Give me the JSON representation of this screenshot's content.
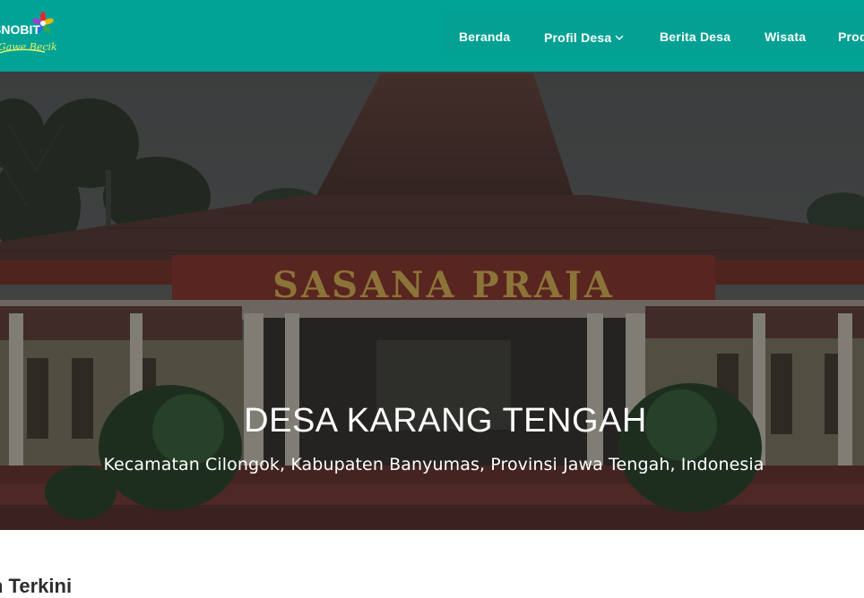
{
  "header": {
    "logo_text": "SNOBIT",
    "logo_tagline": "Gawe Becik",
    "nav": [
      {
        "label": "Beranda"
      },
      {
        "label": "Profil Desa"
      },
      {
        "label": "Berita Desa"
      },
      {
        "label": "Wisata"
      },
      {
        "label": "Prod"
      }
    ]
  },
  "hero": {
    "building_sign": "SASANA PRAJA",
    "title": "DESA KARANG TENGAH",
    "subtitle": "Kecamatan Cilongok, Kabupaten Banyumas, Provinsi Jawa Tengah, Indonesia"
  },
  "section": {
    "title": "n Terkini"
  },
  "colors": {
    "header_bg": "#00a396",
    "nav_text": "#ffffff",
    "hero_overlay": "#1a1a1a"
  }
}
